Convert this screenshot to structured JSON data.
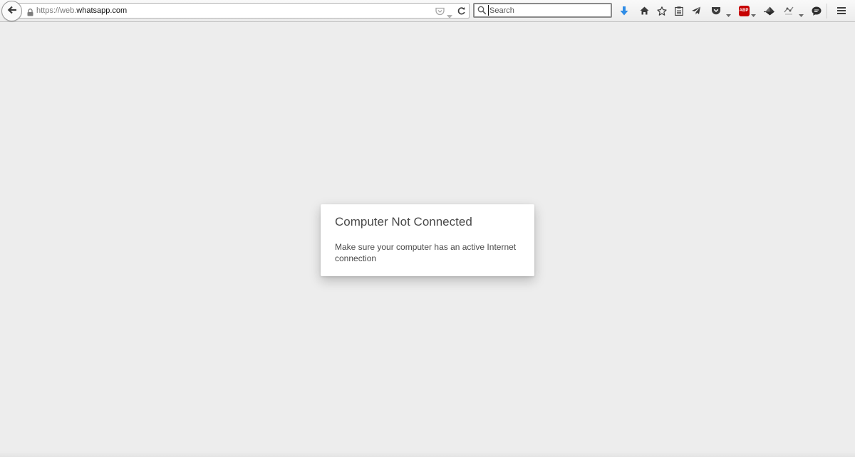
{
  "browser": {
    "url": {
      "prefix": "https://web.",
      "domain": "whatsapp.com"
    },
    "search_placeholder": "Search",
    "toolbar_icons": [
      "back-arrow-icon",
      "lock-icon",
      "pocket-icon",
      "reload-icon",
      "download-icon",
      "home-icon",
      "bookmark-star-icon",
      "reading-list-icon",
      "send-icon",
      "pocket-save-icon",
      "adblock-plus-icon",
      "cloud-sync-icon",
      "extension-icon",
      "chat-icon",
      "menu-icon"
    ],
    "adblock_label": "ABP",
    "colors": {
      "download_accent": "#2f8ce6",
      "adblock_red": "#c60000"
    }
  },
  "dialog": {
    "title": "Computer Not Connected",
    "message": "Make sure your computer has an active Internet connection"
  }
}
